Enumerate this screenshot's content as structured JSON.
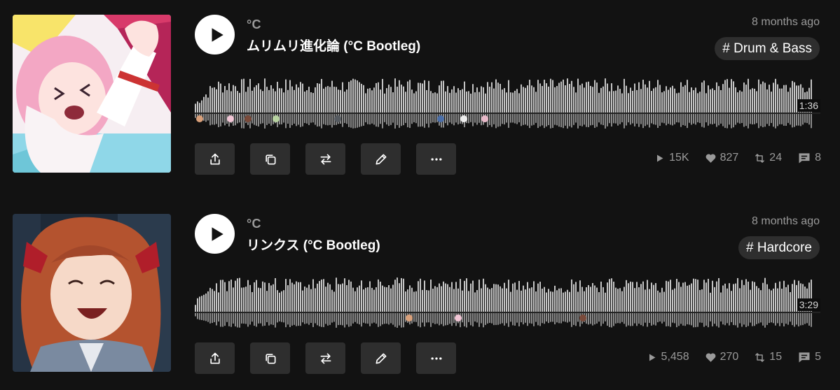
{
  "tracks": [
    {
      "artist": "°C",
      "title": "ムリムリ進化論 (°C Bootleg)",
      "time_ago": "8 months ago",
      "tag": "# Drum & Bass",
      "duration": "1:36",
      "stats": {
        "plays": "15K",
        "likes": "827",
        "reposts": "24",
        "comments": "8"
      },
      "artwork_desc": "pink-haired-anime-character-art"
    },
    {
      "artist": "°C",
      "title": "リンクス (°C Bootleg)",
      "time_ago": "8 months ago",
      "tag": "# Hardcore",
      "duration": "3:29",
      "stats": {
        "plays": "5,458",
        "likes": "270",
        "reposts": "15",
        "comments": "5"
      },
      "artwork_desc": "red-haired-anime-character-art"
    }
  ],
  "icons": {
    "play": "play-icon",
    "share": "share-icon",
    "copy": "copy-link-icon",
    "repost": "repost-icon",
    "edit": "pencil-icon",
    "more": "more-icon",
    "plays": "play-count-icon",
    "likes": "heart-icon",
    "reposts": "repost-count-icon",
    "comments": "comment-icon"
  },
  "colors": {
    "background": "#121212",
    "button_bg": "#2e2e2e",
    "muted_text": "#9a9a9a",
    "waveform": "#c4c4c4"
  }
}
